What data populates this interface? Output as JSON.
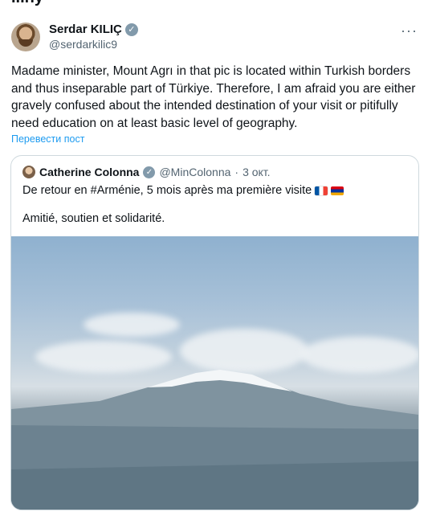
{
  "top_partial_text": "...ny",
  "author": {
    "name": "Serdar KILIÇ",
    "handle": "@serdarkilic9",
    "verified_icon": "verified-badge-icon"
  },
  "post": {
    "text": "Madame minister, Mount Agrı in that pic is located within Turkish borders and thus inseparable part of Türkiye. Therefore, I am afraid you are either gravely confused about the intended destination of your visit or pitifully need education on at least basic level of geography.",
    "translate_label": "Перевести пост",
    "more_label": "···"
  },
  "quote": {
    "name": "Catherine Colonna",
    "handle": "@MinColonna",
    "separator": "·",
    "date": "3 окт.",
    "text_line1": "De retour en #Arménie, 5 mois après ma première visite",
    "text_line2": "Amitié, soutien et solidarité.",
    "flags": [
      "flag-france-icon",
      "flag-armenia-icon"
    ],
    "photo_name": "mount-ararat-photo"
  }
}
